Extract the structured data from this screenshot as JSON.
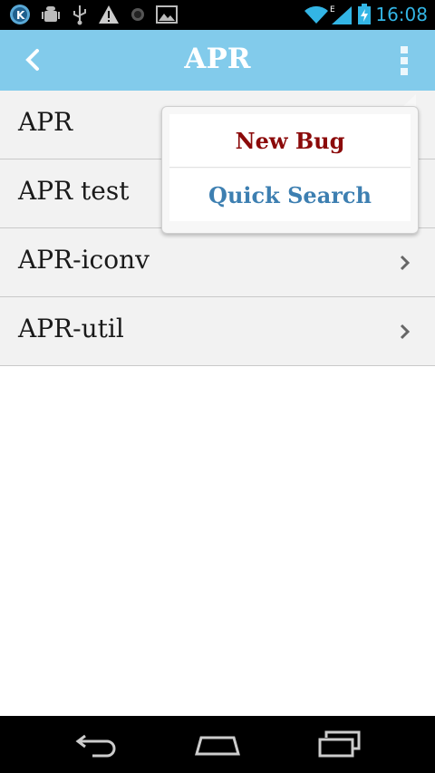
{
  "status_bar": {
    "time": "16:08",
    "icons": [
      "k-app-icon",
      "android-debug-icon",
      "usb-icon",
      "warning-icon",
      "record-icon",
      "image-icon",
      "wifi-icon",
      "signal-icon",
      "battery-charging-icon"
    ],
    "network_type": "E"
  },
  "action_bar": {
    "title": "APR",
    "back_icon": "chevron-left-icon",
    "overflow_icon": "overflow-menu-icon"
  },
  "list": {
    "items": [
      {
        "label": "APR"
      },
      {
        "label": "APR test"
      },
      {
        "label": "APR-iconv"
      },
      {
        "label": "APR-util"
      }
    ]
  },
  "popup_menu": {
    "items": [
      {
        "label": "New Bug",
        "color": "#8b0a0a"
      },
      {
        "label": "Quick Search",
        "color": "#3d7fb1"
      }
    ]
  },
  "nav_bar": {
    "icons": [
      "back-icon",
      "home-icon",
      "recent-apps-icon"
    ]
  },
  "colors": {
    "action_bar": "#82cbeb",
    "status_accent": "#33b5e5"
  }
}
